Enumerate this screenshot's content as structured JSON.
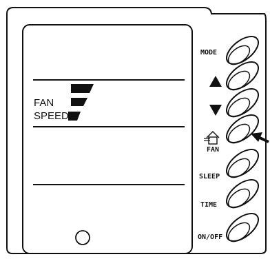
{
  "display": {
    "fan_label": "FAN",
    "speed_label": "SPEED"
  },
  "buttons": {
    "mode": "MODE",
    "up_icon": "triangle-up",
    "down_icon": "triangle-down",
    "fan": "FAN",
    "fan_icon": "house-fan-icon",
    "sleep": "SLEEP",
    "time": "TIME",
    "onoff": "ON/OFF"
  },
  "colors": {
    "ink": "#111111",
    "background": "#ffffff"
  }
}
